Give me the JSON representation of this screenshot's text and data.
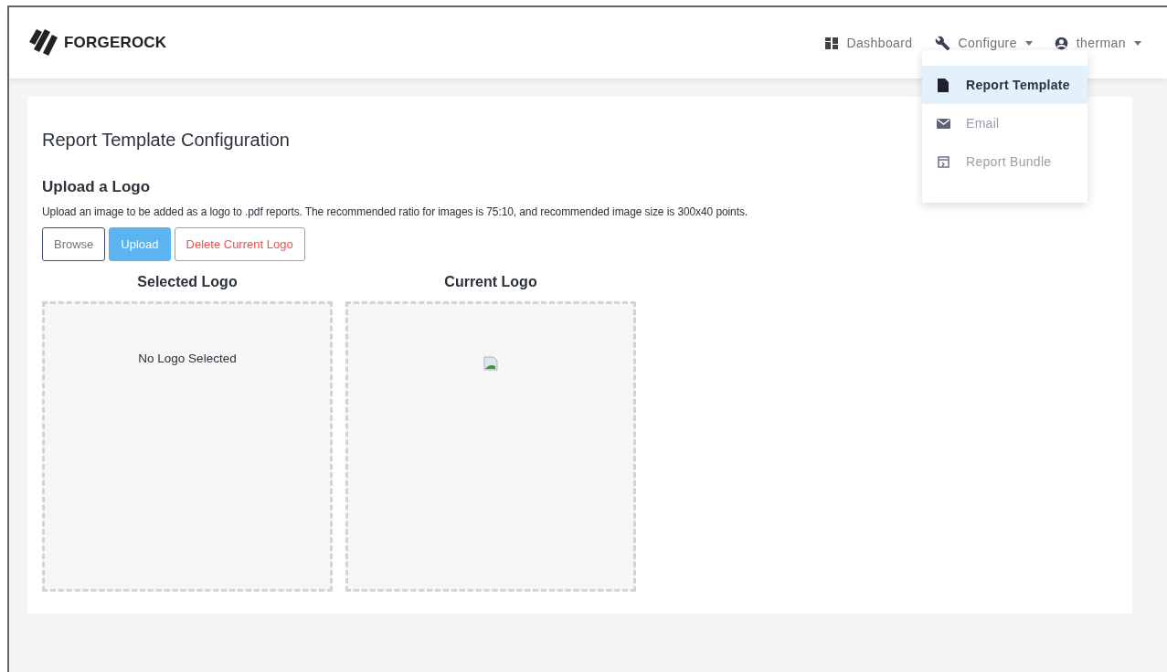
{
  "brand": {
    "name": "FORGEROCK"
  },
  "nav": [
    {
      "label": "Dashboard",
      "kind": "dashboard",
      "caret": false
    },
    {
      "label": "Configure",
      "kind": "configure",
      "caret": true
    },
    {
      "label": "therman",
      "kind": "user",
      "caret": true
    }
  ],
  "dropdown": {
    "items": [
      {
        "label": "Report Template",
        "kind": "file",
        "selected": true
      },
      {
        "label": "Email",
        "kind": "email",
        "selected": false
      },
      {
        "label": "Report Bundle",
        "kind": "bundle",
        "selected": false
      }
    ]
  },
  "page": {
    "title": "Report Template Configuration",
    "section_title": "Upload a Logo",
    "description": "Upload an image to be added as a logo to .pdf reports. The recommended ratio for images is 75:10, and recommended image size is 300x40 points.",
    "buttons": [
      {
        "label": "Browse",
        "kind": "outline"
      },
      {
        "label": "Upload",
        "kind": "primary"
      },
      {
        "label": "Delete Current Logo",
        "kind": "danger"
      }
    ],
    "panels": [
      {
        "title": "Selected Logo",
        "kind": "text",
        "text": "No Logo Selected"
      },
      {
        "title": "Current Logo",
        "kind": "broken-image"
      }
    ]
  }
}
